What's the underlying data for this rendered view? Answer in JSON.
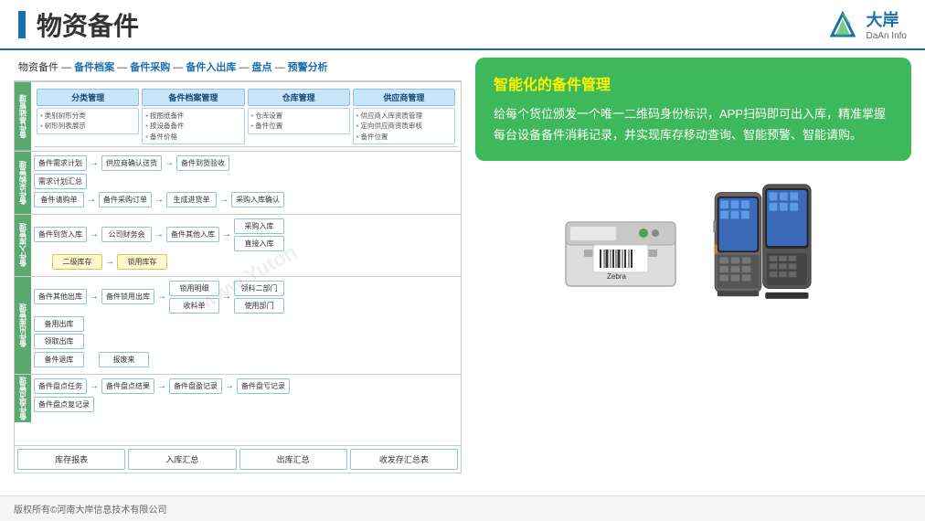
{
  "header": {
    "title": "物资备件",
    "logo_name": "大岸",
    "logo_sub": "DaAn Info"
  },
  "breadcrumb": {
    "items": [
      "物资备件",
      "备件档案",
      "备件采购",
      "备件入出库",
      "盘点",
      "预警分析"
    ],
    "separator": "—"
  },
  "diagram": {
    "sections": [
      {
        "label": "备件基础管理",
        "subsections": [
          {
            "header": "分类管理",
            "items": [
              "类别树形分类",
              "树形列表展示"
            ]
          },
          {
            "header": "备件档案管理",
            "items": [
              "按图纸备件",
              "按设备备件",
              "备件价格"
            ]
          },
          {
            "header": "仓库管理",
            "items": [
              "仓库设置",
              "备件位置"
            ]
          },
          {
            "header": "供应商管理",
            "items": [
              "供应商入库资质管理",
              "定向供应商资质审核",
              ""
            ]
          }
        ]
      },
      {
        "label": "备件采购管理",
        "rows": [
          [
            "备件需求计划",
            "→",
            "供应商确认送货",
            "→",
            "备件到货验收"
          ],
          [
            "需求计划汇总"
          ],
          [
            "备件请购单",
            "→",
            "备件采购订单",
            "→",
            "生成进货单",
            "→",
            "采购入库确认"
          ]
        ]
      },
      {
        "label": "备件入库管理",
        "rows": [
          [
            "备件到货入库",
            "→",
            "公司财务会",
            "→",
            "备件其他入库",
            "→",
            "采购入库",
            "直接入库"
          ],
          [
            "",
            "二级库存",
            "→",
            "锁用库存"
          ],
          [
            "备件其他出库",
            "→",
            "备件锁用出库",
            "→",
            "锁用明细",
            "→",
            "收料单",
            ""
          ]
        ]
      },
      {
        "label": "备件出库管理",
        "rows": [
          [
            "备件其他出库",
            "→",
            "备件锁用出库"
          ],
          [
            "备用出库",
            "领取出库"
          ],
          [
            "备件退库"
          ]
        ]
      },
      {
        "label": "备件盘点管理",
        "rows": [
          [
            "备件盘点任务",
            "→",
            "备件盘点结果",
            "→",
            "备件盘盈记录",
            "→",
            "备件盘亏记录"
          ],
          [
            "备件盘点复记录"
          ]
        ]
      }
    ],
    "stats": [
      "库存报表",
      "入库汇总",
      "出库汇总",
      "收发存汇总表"
    ]
  },
  "right_panel": {
    "card_title": "智能化的备件管理",
    "card_text": "给每个货位颁发一个唯一二维码身份标识，APP扫码即可出入库，精准掌握每台设备备件消耗记录，并实现库存移动查询、智能预警、智能请购。"
  },
  "footer": {
    "text": "版权所有©河南大岸信息技术有限公司"
  },
  "watermark": "www.Yuton"
}
